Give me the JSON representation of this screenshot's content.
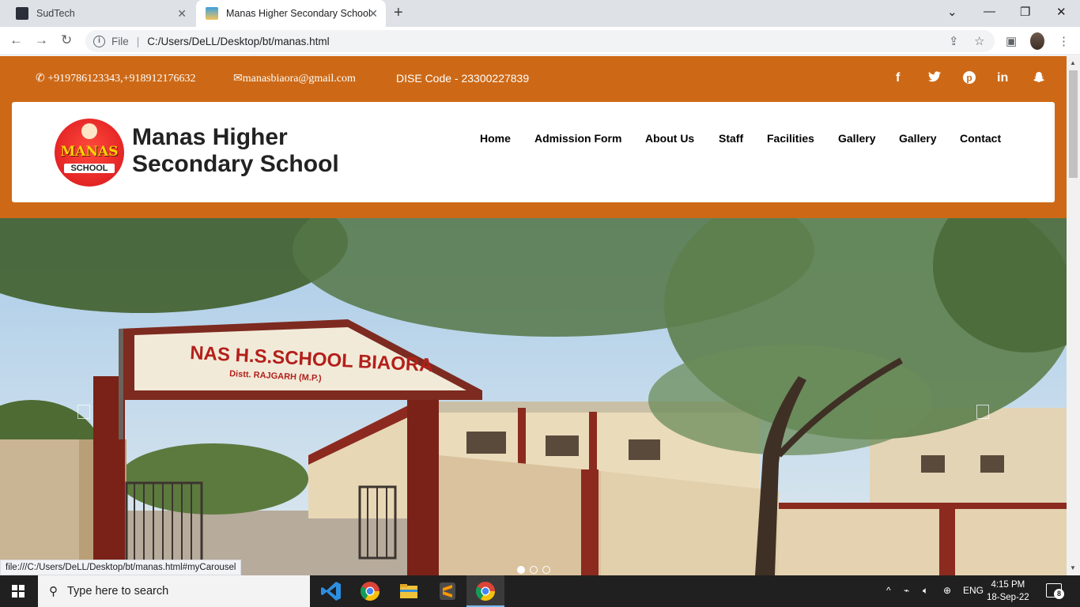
{
  "browser": {
    "tabs": [
      {
        "title": "SudTech",
        "active": false
      },
      {
        "title": "Manas Higher Secondary School",
        "active": true
      }
    ],
    "address": {
      "scheme_label": "File",
      "url": "C:/Users/DeLL/Desktop/bt/manas.html"
    },
    "status_url": "file:///C:/Users/DeLL/Desktop/bt/manas.html#myCarousel"
  },
  "site": {
    "topbar": {
      "phones": "+919786123343,+918912176632",
      "email": "manasbiaora@gmail.com",
      "dise": "DISE Code - 23300227839",
      "socials": [
        "facebook-icon",
        "twitter-icon",
        "pinterest-icon",
        "linkedin-icon",
        "snapchat-icon"
      ]
    },
    "logo": {
      "word1": "MANAS",
      "word2": "SCHOOL"
    },
    "brand": {
      "line1": "Manas Higher",
      "line2": "Secondary School"
    },
    "nav": [
      "Home",
      "Admission Form",
      "About Us",
      "Staff",
      "Facilities",
      "Gallery",
      "Gallery",
      "Contact"
    ],
    "hero": {
      "gate_sign": "NAS H.S.SCHOOL BIAORA",
      "gate_sub": "Distt. RAJGARH (M.P.)",
      "slides": 3,
      "active_slide": 0
    }
  },
  "taskbar": {
    "search_placeholder": "Type here to search",
    "lang": "ENG",
    "time": "4:15 PM",
    "date": "18-Sep-22",
    "notifications": "8"
  },
  "colors": {
    "accent": "#cd6916",
    "brand_text": "#222222"
  }
}
